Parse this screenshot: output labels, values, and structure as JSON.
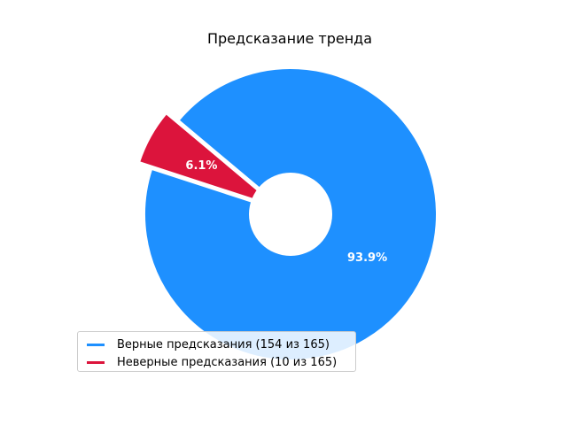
{
  "colors": {
    "correct": "#1e90ff",
    "incorrect": "#dc143c",
    "background": "#ffffff"
  },
  "chart_data": {
    "type": "pie",
    "title": "Предсказание тренда",
    "donut": true,
    "start_angle_deg": 140,
    "direction": "clockwise",
    "slices": [
      {
        "name": "Верные предсказания (154 из 165)",
        "value": 154,
        "percent_label": "93.9%",
        "color": "#1e90ff",
        "exploded": false
      },
      {
        "name": "Неверные предсказания (10 из 165)",
        "value": 10,
        "percent_label": "6.1%",
        "color": "#dc143c",
        "exploded": true
      }
    ],
    "total": 165,
    "legend_position": "lower-left"
  }
}
